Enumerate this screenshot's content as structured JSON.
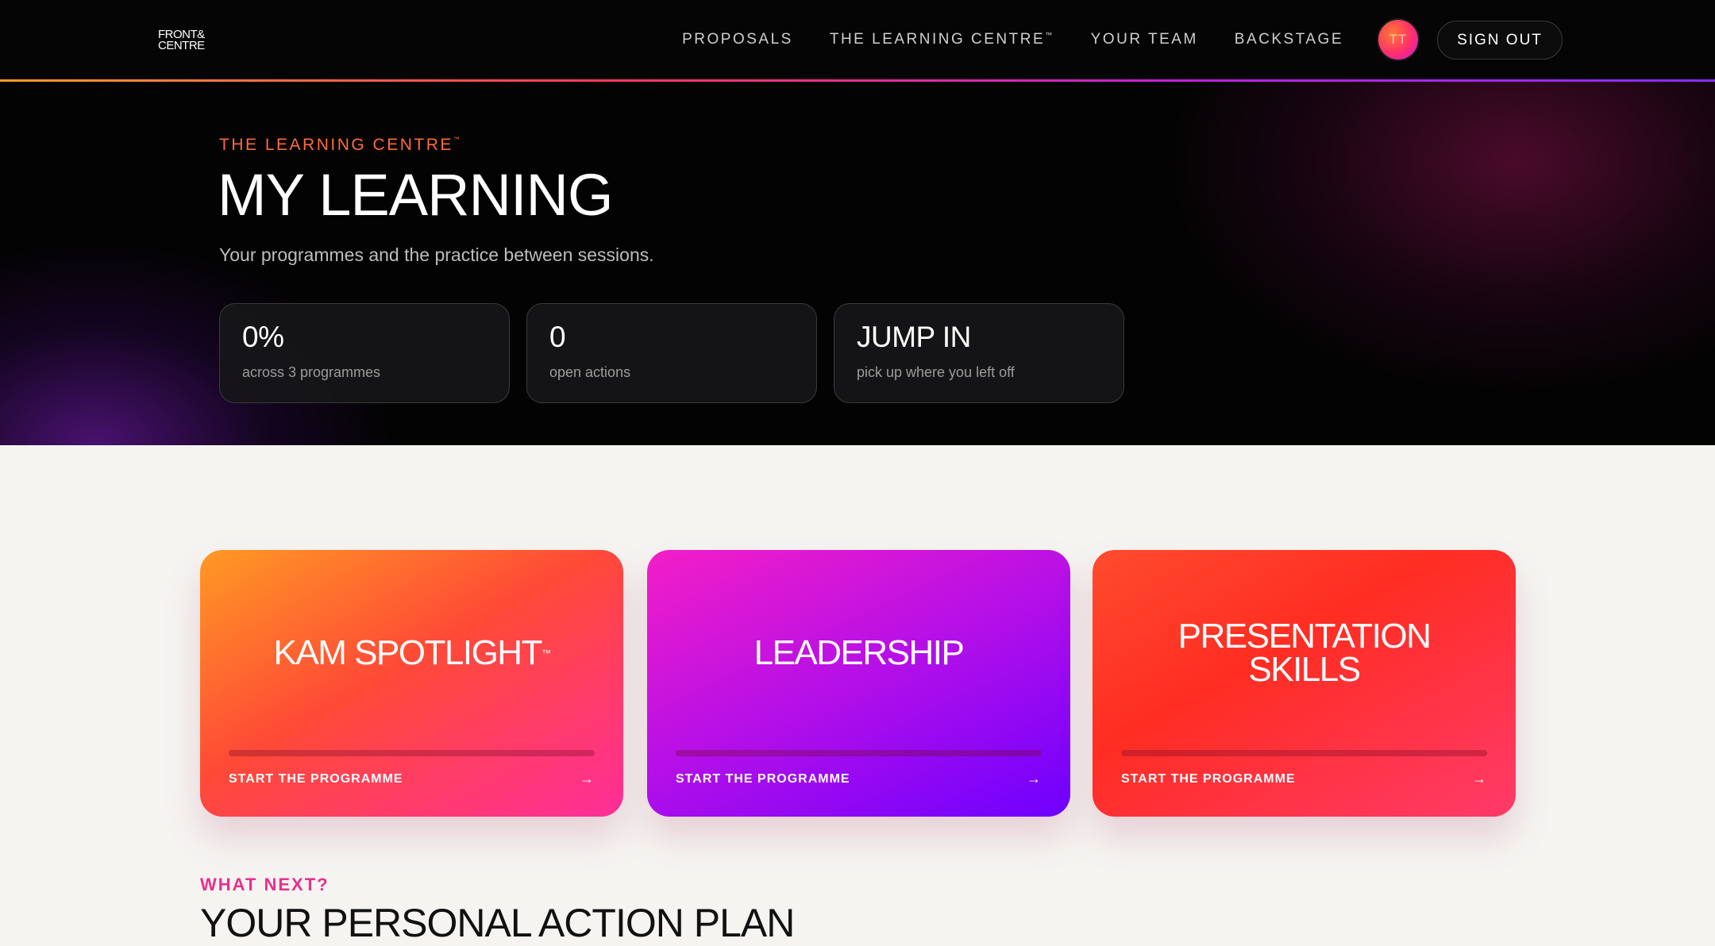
{
  "nav": {
    "logo_line1": "FRONT&",
    "logo_line2": "CENTRE",
    "links": [
      "PROPOSALS",
      "THE LEARNING CENTRE",
      "YOUR TEAM",
      "BACKSTAGE"
    ],
    "avatar_initials": "TT",
    "signout_label": "SIGN OUT"
  },
  "hero": {
    "eyebrow": "THE LEARNING CENTRE",
    "title": "MY LEARNING",
    "subtitle": "Your programmes and the practice between sessions.",
    "stats": [
      {
        "value": "0%",
        "label": "across 3 programmes"
      },
      {
        "value": "0",
        "label": "open actions"
      },
      {
        "value": "JUMP IN",
        "label": "pick up where you left off"
      }
    ]
  },
  "programmes": [
    {
      "title": "KAM SPOTLIGHT",
      "cta": "START THE PROGRAMME",
      "progress": 0
    },
    {
      "title": "LEADERSHIP",
      "cta": "START THE PROGRAMME",
      "progress": 0
    },
    {
      "title": "PRESENTATION SKILLS",
      "cta": "START THE PROGRAMME",
      "progress": 0
    }
  ],
  "next": {
    "eyebrow": "WHAT NEXT?",
    "title": "YOUR PERSONAL ACTION PLAN"
  },
  "colors": {
    "accent_orange": "#ff6a3d",
    "accent_pink": "#ea2f8c",
    "accent_purple": "#8a2cff"
  }
}
